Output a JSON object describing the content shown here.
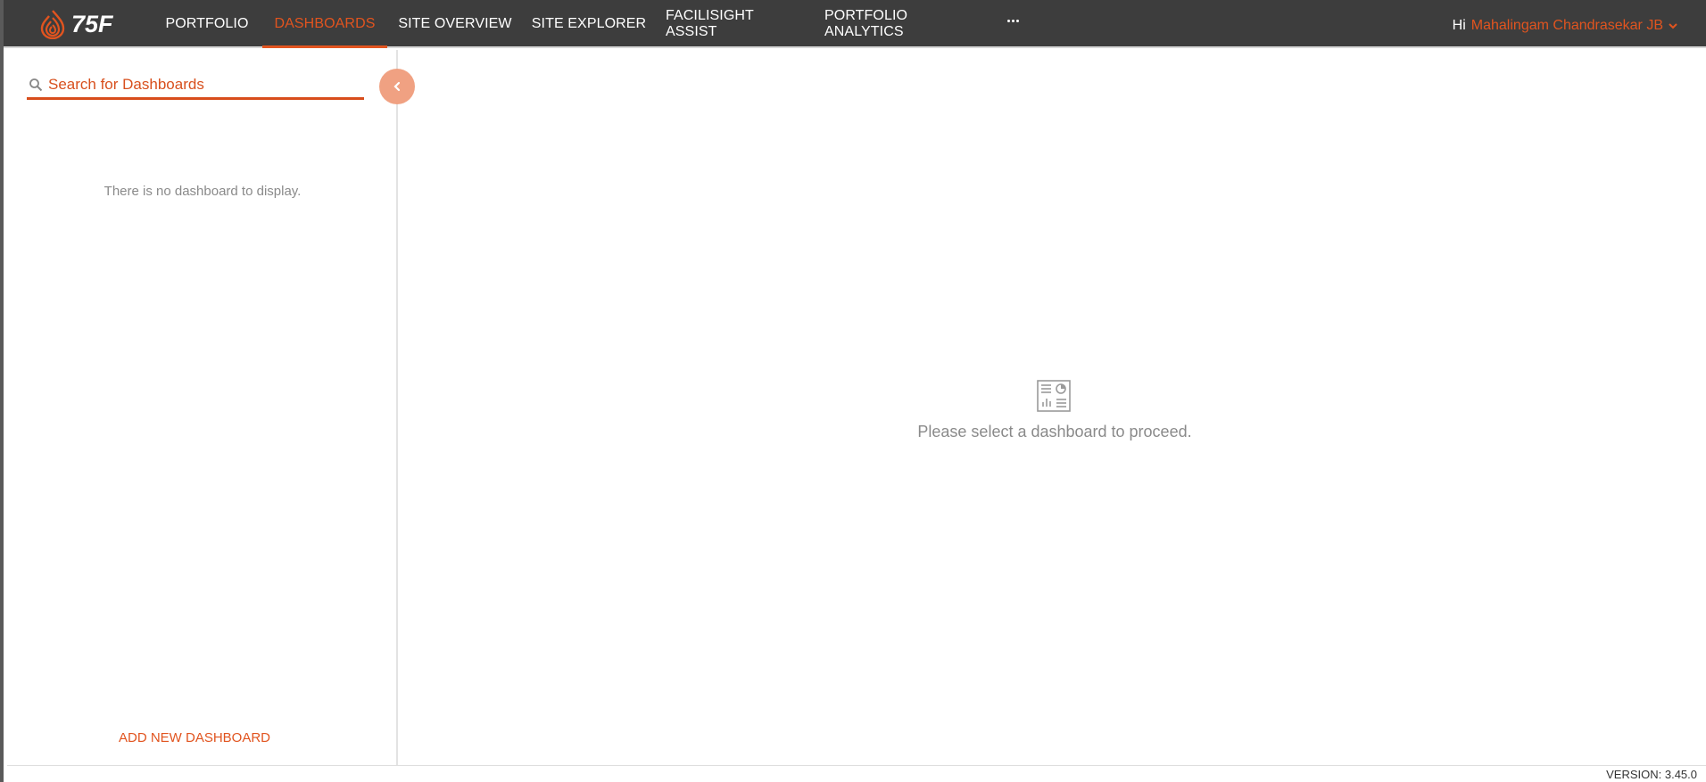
{
  "brand": {
    "logo_text": "75F",
    "accent_color": "#e1541f",
    "nav_bg": "#3d3d3d"
  },
  "nav": {
    "items": [
      {
        "label": "PORTFOLIO",
        "active": false
      },
      {
        "label": "DASHBOARDS",
        "active": true
      },
      {
        "label": "SITE OVERVIEW",
        "active": false
      },
      {
        "label": "SITE EXPLORER",
        "active": false
      },
      {
        "label": "FACILISIGHT ASSIST",
        "active": false
      },
      {
        "label": "PORTFOLIO ANALYTICS",
        "active": false
      }
    ],
    "more_icon": "ellipsis-icon"
  },
  "user": {
    "greeting": "Hi",
    "name": "Mahalingam Chandrasekar JB"
  },
  "sidebar": {
    "search_placeholder": "Search for Dashboards",
    "search_value": "",
    "empty_message": "There is no dashboard to display.",
    "add_button_label": "ADD NEW DASHBOARD",
    "collapse_icon": "chevron-left-icon"
  },
  "main": {
    "empty_icon": "dashboard-icon",
    "empty_message": "Please select a dashboard to proceed."
  },
  "footer": {
    "version": "VERSION: 3.45.0"
  }
}
